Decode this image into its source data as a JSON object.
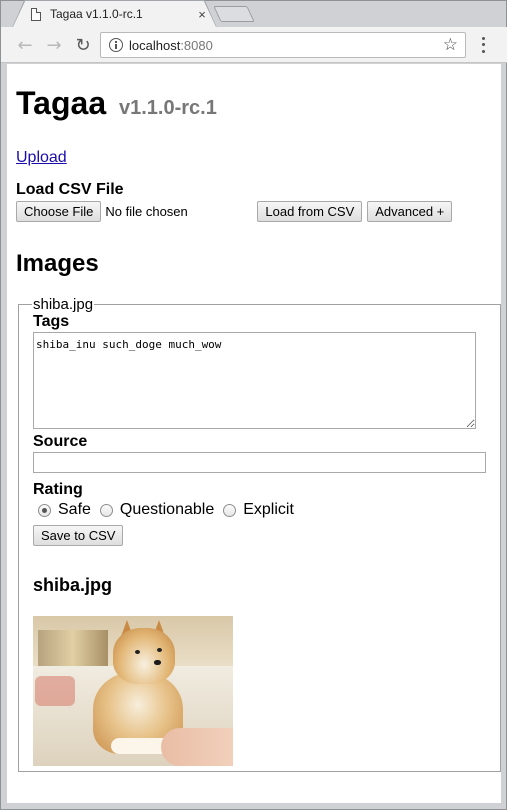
{
  "browser": {
    "tab_title": "Tagaa v1.1.0-rc.1",
    "close_glyph": "×",
    "url_host": "localhost",
    "url_port": ":8080",
    "icons": [
      "page-icon",
      "close-icon",
      "back-icon",
      "forward-icon",
      "reload-icon",
      "info-icon",
      "star-icon",
      "menu-icon"
    ]
  },
  "page": {
    "title": "Tagaa",
    "version": "v1.1.0-rc.1",
    "upload_link": "Upload",
    "load_csv": {
      "label": "Load CSV File",
      "choose_file_button": "Choose File",
      "file_status": "No file chosen",
      "load_button": "Load from CSV",
      "advanced_button": "Advanced +"
    },
    "images_heading": "Images",
    "image_card": {
      "legend": "shiba.jpg",
      "tags_label": "Tags",
      "tags_value": "shiba_inu such_doge much_wow",
      "source_label": "Source",
      "source_value": "",
      "rating_label": "Rating",
      "rating_options": [
        "Safe",
        "Questionable",
        "Explicit"
      ],
      "rating_selected": "Safe",
      "save_button": "Save to CSV",
      "image_heading": "shiba.jpg"
    }
  }
}
